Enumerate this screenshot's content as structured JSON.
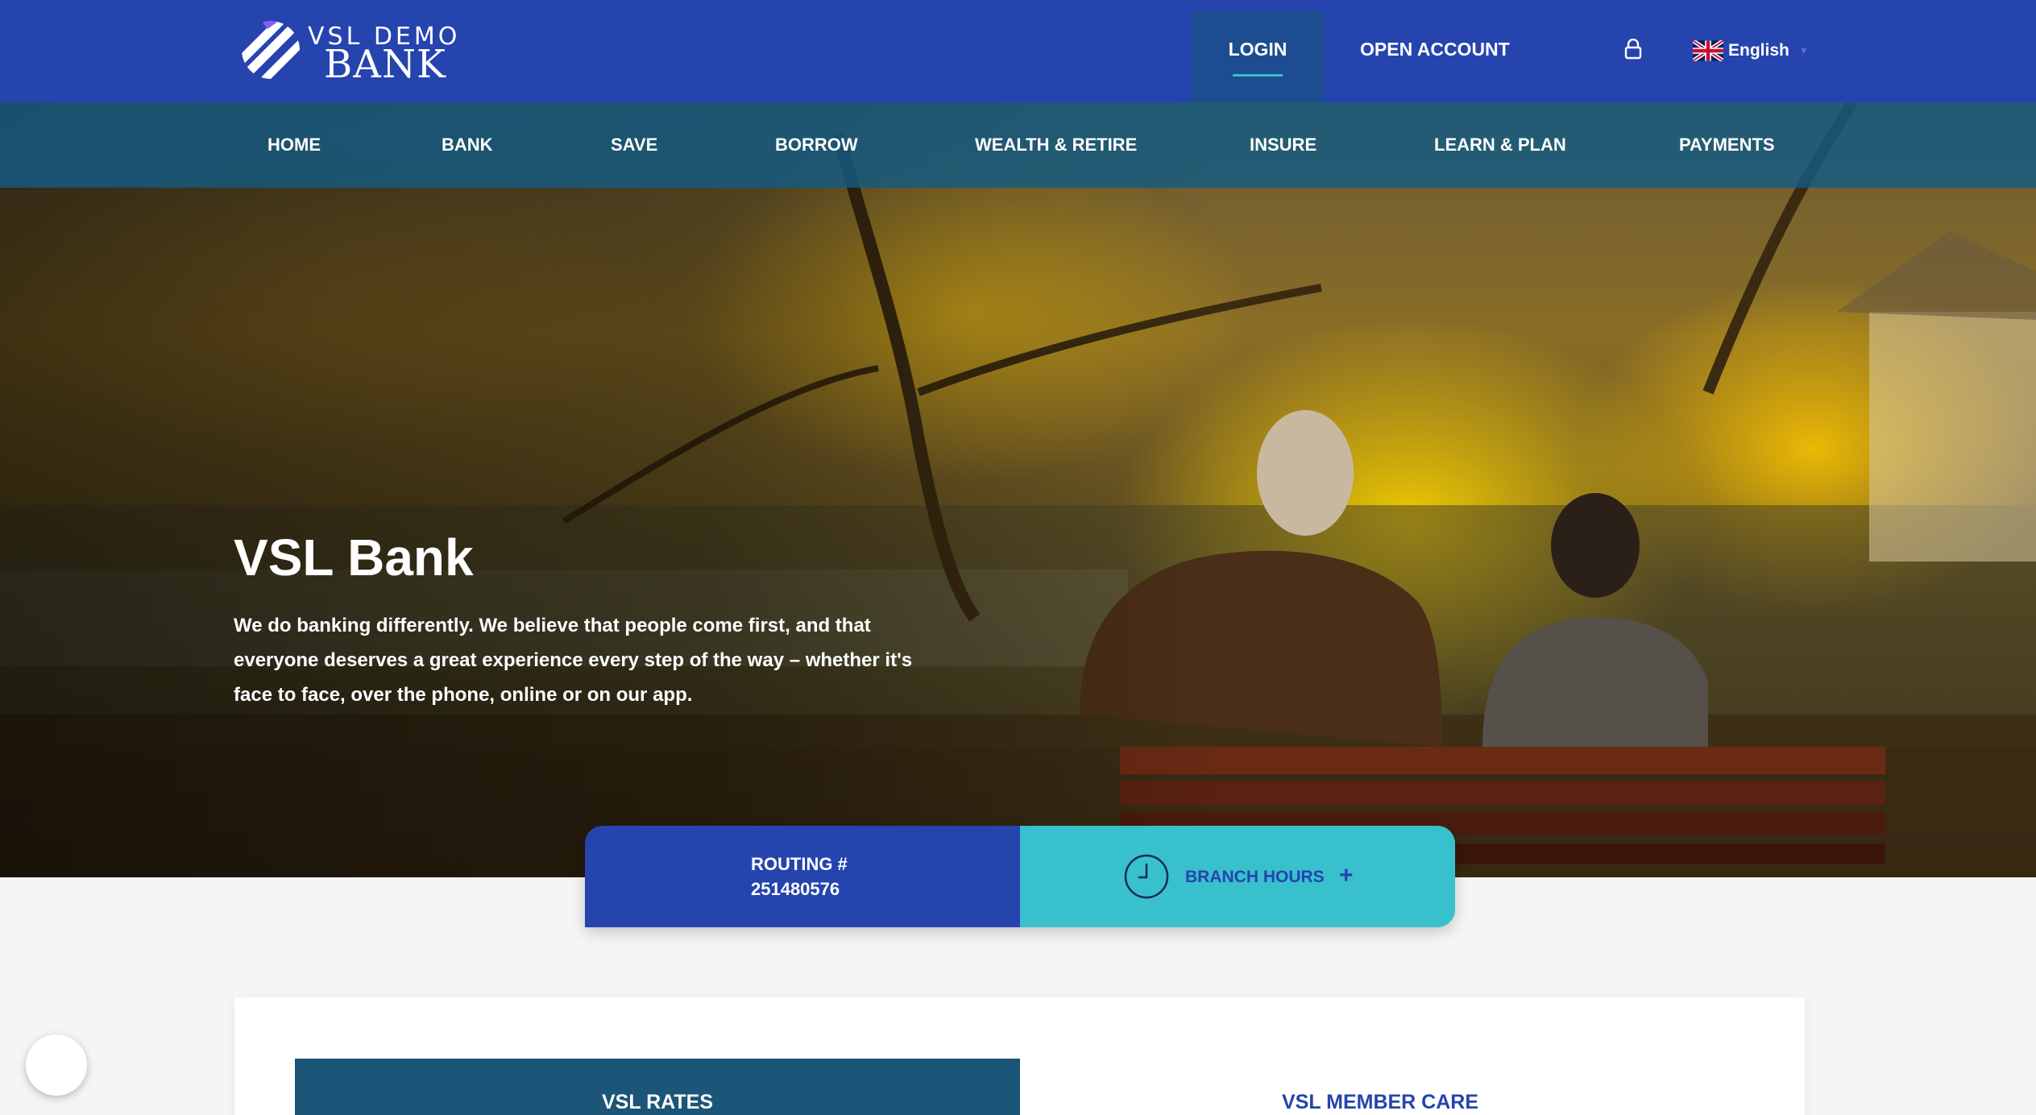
{
  "brand": {
    "logo_top": "VSL DEMO",
    "logo_bottom": "BANK"
  },
  "header": {
    "login_label": "LOGIN",
    "open_account_label": "OPEN ACCOUNT",
    "language": "English"
  },
  "nav": {
    "items": [
      {
        "label": "HOME"
      },
      {
        "label": "BANK"
      },
      {
        "label": "SAVE"
      },
      {
        "label": "BORROW"
      },
      {
        "label": "WEALTH & RETIRE"
      },
      {
        "label": "INSURE"
      },
      {
        "label": "LEARN & PLAN"
      },
      {
        "label": "PAYMENTS"
      }
    ]
  },
  "hero": {
    "title": "VSL Bank",
    "text": "We do banking differently. We believe that people come first, and that everyone deserves a great experience every step of the way – whether it's face to face, over the phone, online or on our app."
  },
  "info": {
    "routing_label": "ROUTING #",
    "routing_number": "251480576",
    "hours_label": "BRANCH HOURS",
    "hours_toggle": "+"
  },
  "panel": {
    "rates_label": "VSL RATES",
    "member_care_label": "VSL MEMBER CARE"
  },
  "colors": {
    "primary": "#2544ae",
    "accent": "#38c0cd",
    "nav_bg": "#1b5a82",
    "rates_bg": "#1b5577"
  },
  "icons": [
    "logo-mark-icon",
    "lock-icon",
    "uk-flag-icon",
    "clock-icon",
    "plus-icon",
    "chat-icon"
  ]
}
